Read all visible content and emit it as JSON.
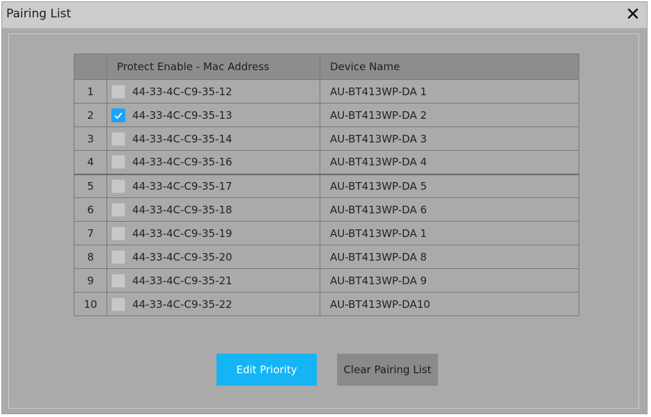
{
  "window": {
    "title": "Pairing List",
    "close_glyph": "✕"
  },
  "table": {
    "headers": [
      "",
      "Protect Enable - Mac Address",
      "Device Name"
    ],
    "rows": [
      {
        "num": "1",
        "checked": false,
        "mac": "44-33-4C-C9-35-12",
        "device": "AU-BT413WP-DA 1"
      },
      {
        "num": "2",
        "checked": true,
        "mac": "44-33-4C-C9-35-13",
        "device": "AU-BT413WP-DA 2"
      },
      {
        "num": "3",
        "checked": false,
        "mac": "44-33-4C-C9-35-14",
        "device": "AU-BT413WP-DA 3"
      },
      {
        "num": "4",
        "checked": false,
        "mac": "44-33-4C-C9-35-16",
        "device": "AU-BT413WP-DA 4"
      },
      {
        "num": "5",
        "checked": false,
        "mac": "44-33-4C-C9-35-17",
        "device": "AU-BT413WP-DA 5"
      },
      {
        "num": "6",
        "checked": false,
        "mac": "44-33-4C-C9-35-18",
        "device": "AU-BT413WP-DA 6"
      },
      {
        "num": "7",
        "checked": false,
        "mac": "44-33-4C-C9-35-19",
        "device": "AU-BT413WP-DA 1"
      },
      {
        "num": "8",
        "checked": false,
        "mac": "44-33-4C-C9-35-20",
        "device": "AU-BT413WP-DA 8"
      },
      {
        "num": "9",
        "checked": false,
        "mac": "44-33-4C-C9-35-21",
        "device": "AU-BT413WP-DA 9"
      },
      {
        "num": "10",
        "checked": false,
        "mac": "44-33-4C-C9-35-22",
        "device": "AU-BT413WP-DA10"
      }
    ]
  },
  "buttons": {
    "edit_priority": "Edit Priority",
    "clear_pairing_list": "Clear Pairing List"
  },
  "colors": {
    "accent": "#14b4f5",
    "dialog_bg": "#aaaaaa",
    "titlebar_bg": "#cccccc",
    "header_bg": "#8d8d8d"
  },
  "icons": {
    "close": "close-icon",
    "check": "checkmark-icon"
  }
}
